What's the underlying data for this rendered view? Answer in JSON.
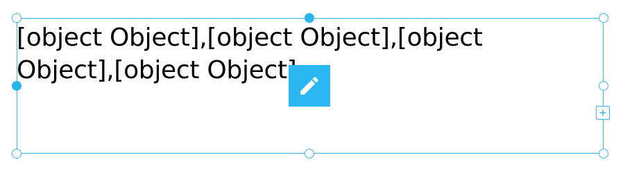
{
  "text_box": {
    "content": "[object Object],[object Object],[object Object],[object Object]"
  },
  "icons": {
    "edit": "pencil-icon",
    "add": "plus-icon"
  },
  "colors": {
    "accent": "#29b6f2",
    "border": "#3db3e3",
    "text": "#000000",
    "background": "#ffffff"
  }
}
